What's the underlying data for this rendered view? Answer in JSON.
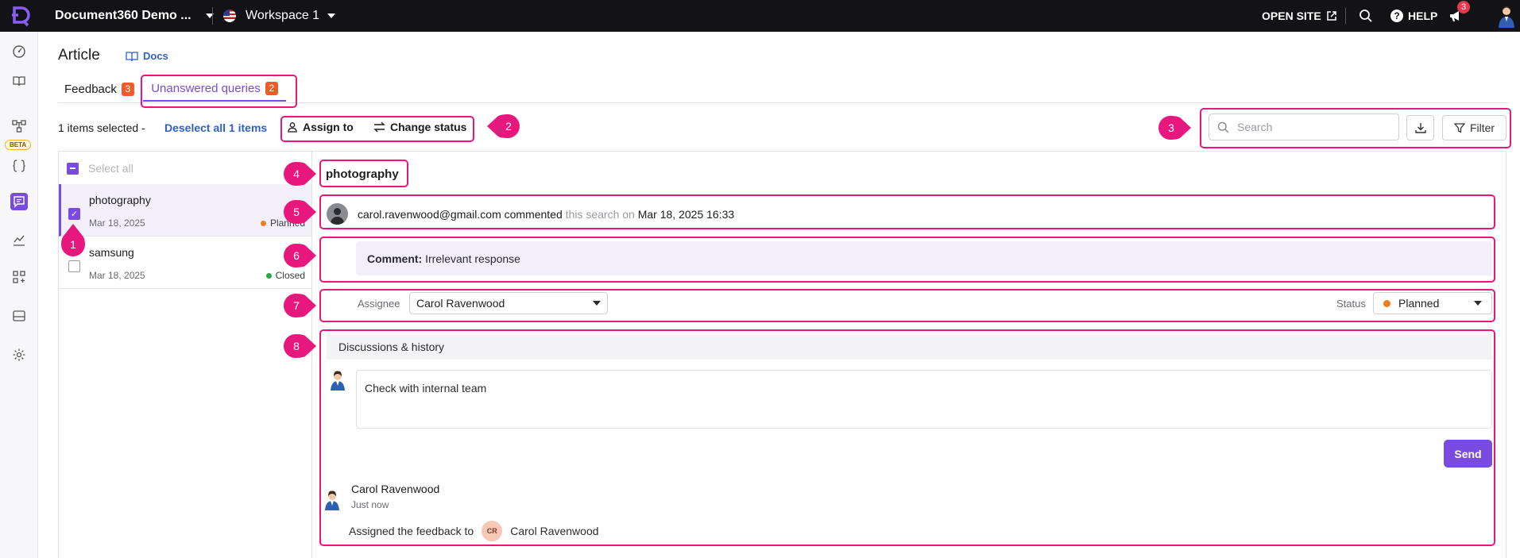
{
  "topbar": {
    "project_name": "Document360 Demo ...",
    "workspace": "Workspace 1",
    "open_site": "OPEN SITE",
    "help": "HELP",
    "notification_count": "3"
  },
  "rail": {
    "beta_label": "BETA",
    "icons": [
      "dashboard-icon",
      "book-icon",
      "workflow-icon",
      "api-icon",
      "feedback-icon",
      "analytics-icon",
      "apps-icon",
      "widget-icon",
      "settings-icon"
    ]
  },
  "header": {
    "title": "Article",
    "docs_link": "Docs"
  },
  "tabs": [
    {
      "label": "Feedback",
      "count": "3"
    },
    {
      "label": "Unanswered queries",
      "count": "2"
    }
  ],
  "actions": {
    "selected_text": "1 items selected -",
    "deselect": "Deselect all 1 items",
    "assign": "Assign to",
    "change_status": "Change status",
    "search_placeholder": "Search",
    "filter": "Filter"
  },
  "list": {
    "select_all": "Select all",
    "items": [
      {
        "title": "photography",
        "date": "Mar 18, 2025",
        "status": "Planned",
        "status_color": "#f07c1e"
      },
      {
        "title": "samsung",
        "date": "Mar 18, 2025",
        "status": "Closed",
        "status_color": "#27a844"
      }
    ]
  },
  "detail": {
    "title": "photography",
    "commenter": "carol.ravenwood@gmail.com",
    "commented": "commented",
    "this_search_on": "this search on",
    "timestamp": "Mar 18, 2025 16:33",
    "comment_label": "Comment:",
    "comment_text": "Irrelevant response",
    "assignee_label": "Assignee",
    "assignee_value": "Carol Ravenwood",
    "status_label": "Status",
    "status_value": "Planned",
    "status_color": "#f07c1e",
    "discussions_header": "Discussions & history",
    "discussion_input": "Check with internal team",
    "send": "Send",
    "history": {
      "name": "Carol Ravenwood",
      "time": "Just now",
      "text": "Assigned the feedback to",
      "initials": "CR",
      "assignee": "Carol Ravenwood"
    }
  },
  "callouts": [
    "1",
    "2",
    "3",
    "4",
    "5",
    "6",
    "7",
    "8"
  ],
  "colors": {
    "accent": "#7a4be0",
    "highlight": "#e8177d",
    "topbar": "#131217",
    "badge": "#f15a29"
  }
}
